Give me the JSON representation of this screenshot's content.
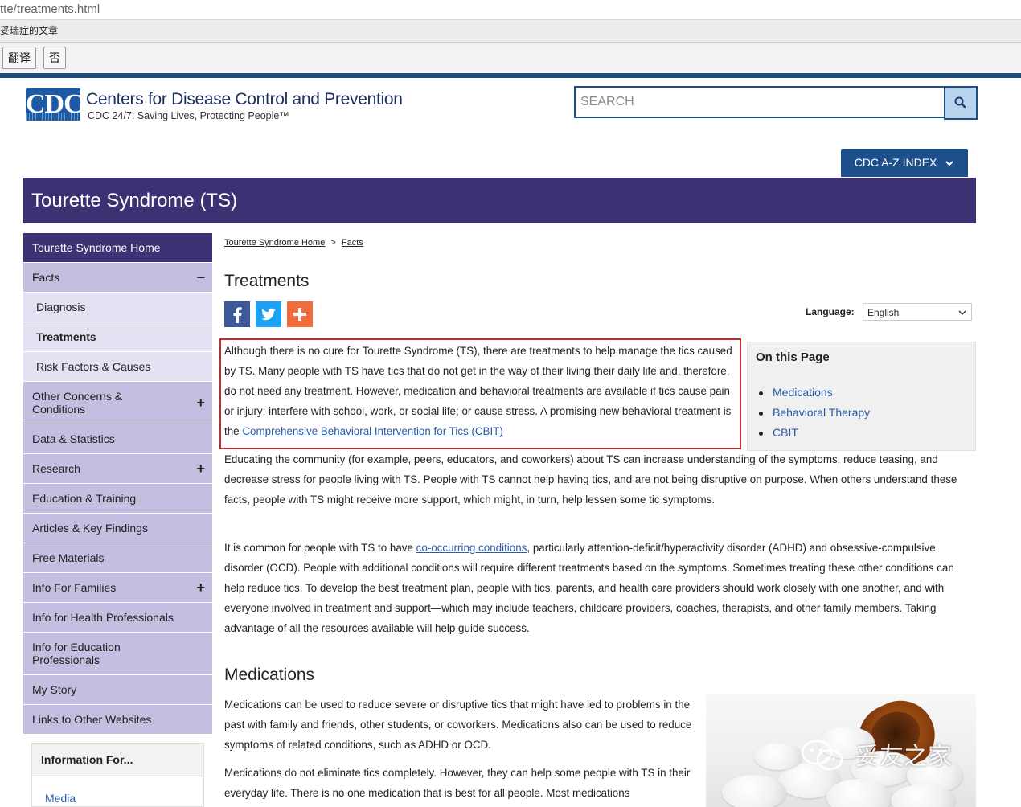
{
  "browser": {
    "url": "tte/treatments.html",
    "tab_title": "妥瑞症的文章",
    "translate_button": "翻译",
    "no_button": "否"
  },
  "header": {
    "logo_text": "CDC",
    "org_name": "Centers for Disease Control and Prevention",
    "tagline": "CDC 24/7: Saving Lives, Protecting People™",
    "search_placeholder": "SEARCH",
    "az_index_label": "CDC A-Z INDEX",
    "banner_title": "Tourette Syndrome (TS)"
  },
  "sidebar": {
    "items": [
      {
        "label": "Tourette Syndrome Home"
      },
      {
        "label": "Facts",
        "toggle": "−"
      },
      {
        "label": "Diagnosis"
      },
      {
        "label": "Treatments"
      },
      {
        "label": "Risk Factors & Causes"
      },
      {
        "label": "Other Concerns & Conditions",
        "toggle": "+"
      },
      {
        "label": "Data & Statistics"
      },
      {
        "label": "Research",
        "toggle": "+"
      },
      {
        "label": "Education & Training"
      },
      {
        "label": "Articles & Key Findings"
      },
      {
        "label": "Free Materials"
      },
      {
        "label": "Info For Families",
        "toggle": "+"
      },
      {
        "label": "Info for Health Professionals"
      },
      {
        "label": "Info for Education Professionals"
      },
      {
        "label": "My Story"
      },
      {
        "label": "Links to Other Websites"
      }
    ],
    "info_box": {
      "title": "Information For...",
      "link": "Media"
    }
  },
  "content": {
    "breadcrumb": [
      "Tourette Syndrome Home",
      "Facts"
    ],
    "breadcrumb_sep": ">",
    "page_title": "Treatments",
    "language_label": "Language:",
    "language_value": "English",
    "intro_text": "Although there is no cure for Tourette Syndrome (TS), there are treatments to help manage the tics caused by TS. Many people with TS have tics that do not get in the way of their living their daily life and, therefore, do not need any treatment. However, medication and behavioral treatments are available if tics cause pain or injury; interfere with school, work, or social life; or cause stress. A promising new behavioral treatment is the ",
    "intro_link": "Comprehensive Behavioral Intervention for Tics (CBIT)",
    "para2": "Educating the community (for example, peers, educators, and coworkers) about TS can increase understanding of the symptoms, reduce teasing, and decrease stress for people living with TS. People with TS cannot help having tics, and are not being disruptive on purpose. When others understand these facts, people with TS might receive more support, which might, in turn, help lessen some tic symptoms.",
    "para3_before": "It is common for people with TS to have ",
    "para3_link": "co-occurring conditions",
    "para3_after": ", particularly attention-deficit/hyperactivity disorder (ADHD) and obsessive-compulsive disorder (OCD). People with additional conditions will require different treatments based on the symptoms. Sometimes treating these other conditions can help reduce tics. To develop the best treatment plan, people with tics, parents, and health care providers should work closely with one another, and with everyone involved in treatment and support—which may include teachers, childcare providers, coaches, therapists, and other family members. Taking advantage of all the resources available will help guide success.",
    "on_this_page": {
      "title": "On this Page",
      "links": [
        "Medications",
        "Behavioral Therapy",
        "CBIT"
      ]
    },
    "medications_heading": "Medications",
    "med_para1": "Medications can be used to reduce severe or disruptive tics that might have led to problems in the past with family and friends, other students, or coworkers. Medications also can be used to reduce symptoms of related conditions, such as ADHD or OCD.",
    "med_para2": "Medications do not eliminate tics completely. However, they can help some people with TS in their everyday life. There is no one medication that is best for all people. Most medications",
    "watermark": "妥友之家"
  },
  "colors": {
    "banner": "#3e3173",
    "nav_level1": "#c4bfe0",
    "nav_level2": "#e4e2f2",
    "link": "#2a5aa8",
    "highlight_box": "#c9262c",
    "facebook": "#3b5998",
    "twitter": "#1da1f2",
    "addthis": "#f26b3a"
  },
  "icons": {
    "search": "search-icon",
    "share": [
      "facebook-icon",
      "twitter-icon",
      "addthis-plus-icon"
    ],
    "dropdown": "chevron-down-icon"
  }
}
